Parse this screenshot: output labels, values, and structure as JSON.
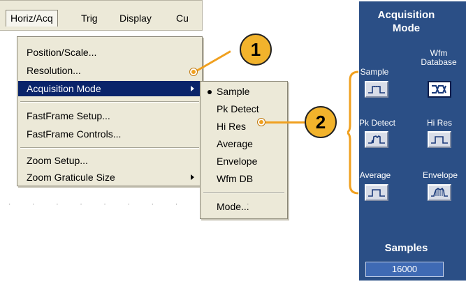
{
  "menubar": {
    "items": [
      "Horiz/Acq",
      "Trig",
      "Display",
      "Cu"
    ]
  },
  "dropdown": {
    "items": [
      "Position/Scale...",
      "Resolution...",
      "Acquisition Mode",
      "FastFrame Setup...",
      "FastFrame Controls...",
      "Zoom Setup...",
      "Zoom Graticule Size"
    ]
  },
  "submenu": {
    "items": [
      "Sample",
      "Pk Detect",
      "Hi Res",
      "Average",
      "Envelope",
      "Wfm DB",
      "Mode..."
    ],
    "selected": "Sample"
  },
  "callouts": [
    "1",
    "2"
  ],
  "panel": {
    "title_line1": "Acquisition",
    "title_line2": "Mode",
    "modes": [
      {
        "label": "Sample",
        "icon": "sample-wave-icon"
      },
      {
        "label": "Wfm Database",
        "label_line1": "Wfm",
        "label_line2": "Database",
        "icon": "wfm-database-icon",
        "selected": true
      },
      {
        "label": "Pk Detect",
        "icon": "peak-detect-wave-icon"
      },
      {
        "label": "Hi Res",
        "icon": "hi-res-wave-icon"
      },
      {
        "label": "Average",
        "icon": "average-wave-icon"
      },
      {
        "label": "Envelope",
        "icon": "envelope-wave-icon"
      }
    ],
    "samples_label": "Samples",
    "samples_value": "16000"
  },
  "colors": {
    "panel_bg": "#2b4f86",
    "menu_highlight": "#0a246a",
    "callout_fill": "#f2b32c",
    "callout_line": "#f0a01f"
  }
}
